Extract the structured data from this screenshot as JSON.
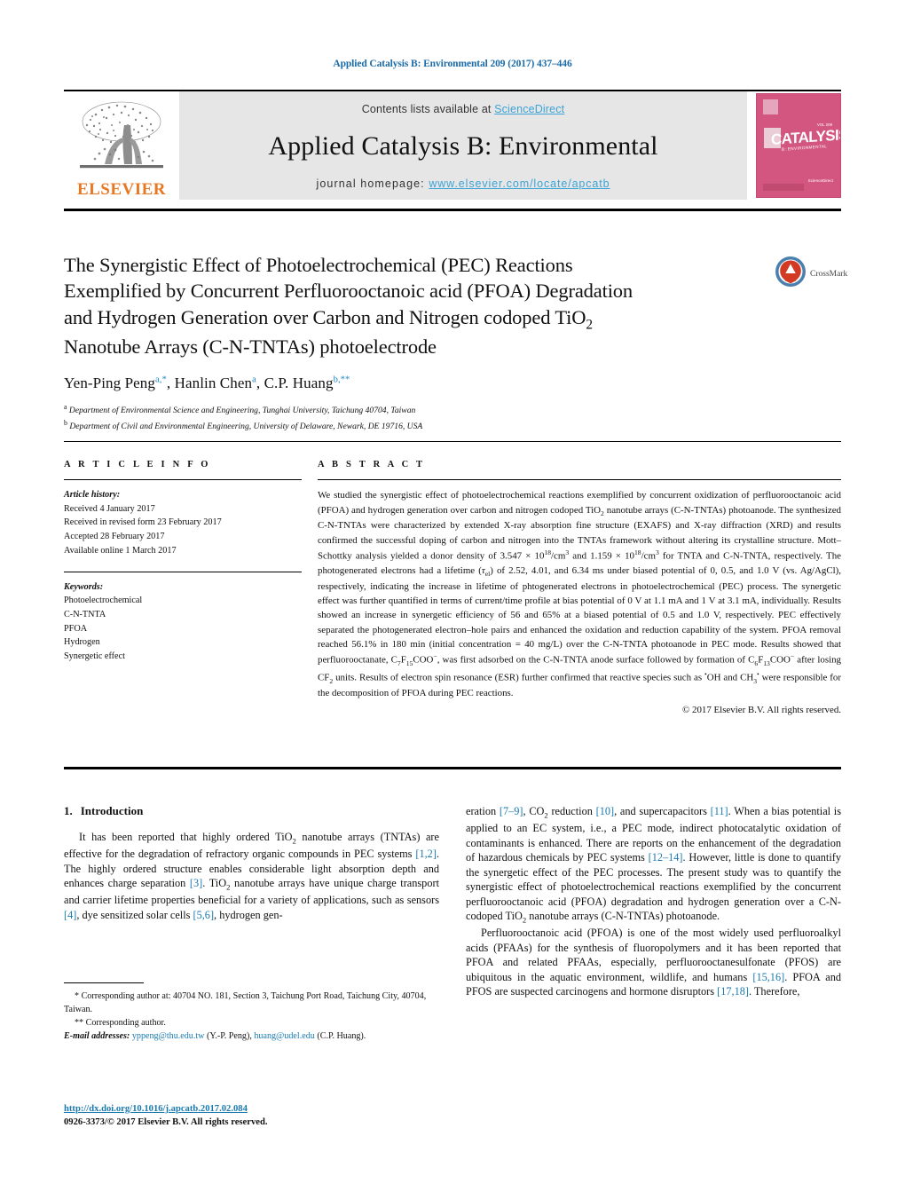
{
  "running_head": "Applied Catalysis B: Environmental 209 (2017) 437–446",
  "journal_header": {
    "publisher_name": "ELSEVIER",
    "contents_prefix": "Contents lists available at ",
    "contents_link": "ScienceDirect",
    "journal_title": "Applied Catalysis B: Environmental",
    "homepage_prefix": "journal homepage: ",
    "homepage_link": "www.elsevier.com/locate/apcatb",
    "cover": {
      "word": "CATALYSIS",
      "subtitle": "B: ENVIRONMENTAL",
      "corner_text": "VOL 209",
      "sd_text": "Available at<br>ScienceDirect"
    },
    "link_color": "#3ca3d6",
    "band_color": "#e6e6e6",
    "elsevier_orange": "#E87722",
    "cover_color": "#d2567f"
  },
  "article": {
    "title_line1": "The Synergistic Effect of Photoelectrochemical (PEC) Reactions",
    "title_line2": "Exemplified by Concurrent Perfluorooctanoic acid (PFOA) Degradation",
    "title_line3_a": "and Hydrogen Generation over Carbon and Nitrogen codoped TiO",
    "title_line3_sub": "2",
    "title_line4": "Nanotube Arrays (C-N-TNTAs) photoelectrode",
    "crossmark_label": "CrossMark",
    "authors": {
      "a1_name": "Yen-Ping Peng",
      "a1_sup": "a,*",
      "sep1": ", ",
      "a2_name": "Hanlin Chen",
      "a2_sup": "a",
      "sep2": ", ",
      "a3_name": "C.P. Huang",
      "a3_sup": "b,**"
    },
    "affiliations": [
      {
        "marker": "a",
        "text": "Department of Environmental Science and Engineering, Tunghai University, Taichung 40704, Taiwan"
      },
      {
        "marker": "b",
        "text": "Department of Civil and Environmental Engineering, University of Delaware, Newark, DE 19716, USA"
      }
    ]
  },
  "article_info": {
    "heading": "A R T I C L E  I N F O",
    "history_title": "Article history:",
    "history": [
      "Received 4 January 2017",
      "Received in revised form 23 February 2017",
      "Accepted 28 February 2017",
      "Available online 1 March 2017"
    ],
    "keywords_title": "Keywords:",
    "keywords": [
      "Photoelectrochemical",
      "C-N-TNTA",
      "PFOA",
      "Hydrogen",
      "Synergetic effect"
    ]
  },
  "abstract": {
    "heading": "A B S T R A C T",
    "paragraph_html": "We studied the synergistic effect of photoelectrochemical reactions exemplified by concurrent oxidization of perfluorooctanoic acid (PFOA) and hydrogen generation over carbon and nitrogen codoped TiO<sub>2</sub> nanotube arrays (C-N-TNTAs) photoanode. The synthesized C-N-TNTAs were characterized by extended X-ray absorption fine structure (EXAFS) and X-ray diffraction (XRD) and results confirmed the successful doping of carbon and nitrogen into the TNTAs framework without altering its crystalline structure. Mott–Schottky analysis yielded a donor density of 3.547 × 10<sup>18</sup>/cm<sup>3</sup> and 1.159 × 10<sup>18</sup>/cm<sup>3</sup> for TNTA and C-N-TNTA, respectively. The photogenerated electrons had a lifetime (<i>τ</i><sub>el</sub>) of 2.52, 4.01, and 6.34 ms under biased potential of 0, 0.5, and 1.0 V (vs. Ag/AgCl), respectively, indicating the increase in lifetime of phtogenerated electrons in photoelectrochemical (PEC) process. The synergetic effect was further quantified in terms of current/time profile at bias potential of 0 V at 1.1 mA and 1 V at 3.1 mA, individually. Results showed an increase in synergetic efficiency of 56 and 65% at a biased potential of 0.5 and 1.0 V, respectively. PEC effectively separated the photogenerated electron–hole pairs and enhanced the oxidation and reduction capability of the system. PFOA removal reached 56.1% in 180 min (initial concentration = 40 mg/L) over the C-N-TNTA photoanode in PEC mode. Results showed that perfluorooctanate, C<sub>7</sub>F<sub>15</sub>COO<sup>−</sup>, was first adsorbed on the C-N-TNTA anode surface followed by formation of C<sub>6</sub>F<sub>13</sub>COO<sup>−</sup> after losing CF<sub>2</sub> units. Results of electron spin resonance (ESR) further confirmed that reactive species such as <sup>•</sup>OH and CH<sub>3</sub><sup>•</sup> were responsible for the decomposition of PFOA during PEC reactions.",
    "copyright": "© 2017 Elsevier B.V. All rights reserved."
  },
  "body": {
    "section_number": "1.",
    "section_title": "Introduction",
    "left_paragraph_html": "It has been reported that highly ordered TiO<sub>2</sub> nanotube arrays (TNTAs) are effective for the degradation of refractory organic compounds in PEC systems <span class=\"ref\">[1,2]</span>. The highly ordered structure enables considerable light absorption depth and enhances charge separation <span class=\"ref\">[3]</span>. TiO<sub>2</sub> nanotube arrays have unique charge transport and carrier lifetime properties beneficial for a variety of applications, such as sensors <span class=\"ref\">[4]</span>, dye sensitized solar cells <span class=\"ref\">[5,6]</span>, hydrogen gen-",
    "right_paragraph1_html": "eration <span class=\"ref\">[7–9]</span>, CO<sub>2</sub> reduction <span class=\"ref\">[10]</span>, and supercapacitors <span class=\"ref\">[11]</span>. When a bias potential is applied to an EC system, i.e., a PEC mode, indirect photocatalytic oxidation of contaminants is enhanced. There are reports on the enhancement of the degradation of hazardous chemicals by PEC systems <span class=\"ref\">[12–14]</span>. However, little is done to quantify the synergetic effect of the PEC processes. The present study was to quantify the synergistic effect of photoelectrochemical reactions exemplified by the concurrent perfluorooctanoic acid (PFOA) degradation and hydrogen generation over a C-N-codoped TiO<sub>2</sub> nanotube arrays (C-N-TNTAs) photoanode.",
    "right_paragraph2_html": "Perfluorooctanoic acid (PFOA) is one of the most widely used perfluoroalkyl acids (PFAAs) for the synthesis of fluoropolymers and it has been reported that PFOA and related PFAAs, especially, perfluorooctanesulfonate (PFOS) are ubiquitous in the aquatic environment, wildlife, and humans <span class=\"ref\">[15,16]</span>. PFOA and PFOS are suspected carcinogens and hormone disruptors <span class=\"ref\">[17,18]</span>. Therefore,"
  },
  "footnotes": {
    "corr1_html": "<span class=\"lead\">* Corresponding author at: 40704 NO. 181, Section 3, Taichung Port Road, Taichung City, 40704, Taiwan.</span>",
    "corr2_html": "<span class=\"lead\">** Corresponding author.</span>",
    "emails_html": "<span class=\"em\">E-mail addresses:</span> <span class=\"link\">yppeng@thu.edu.tw</span> (Y.-P. Peng), <span class=\"link\">huang@udel.edu</span> (C.P. Huang).",
    "doi": "http://dx.doi.org/10.1016/j.apcatb.2017.02.084",
    "issn": "0926-3373/© 2017 Elsevier B.V. All rights reserved."
  }
}
